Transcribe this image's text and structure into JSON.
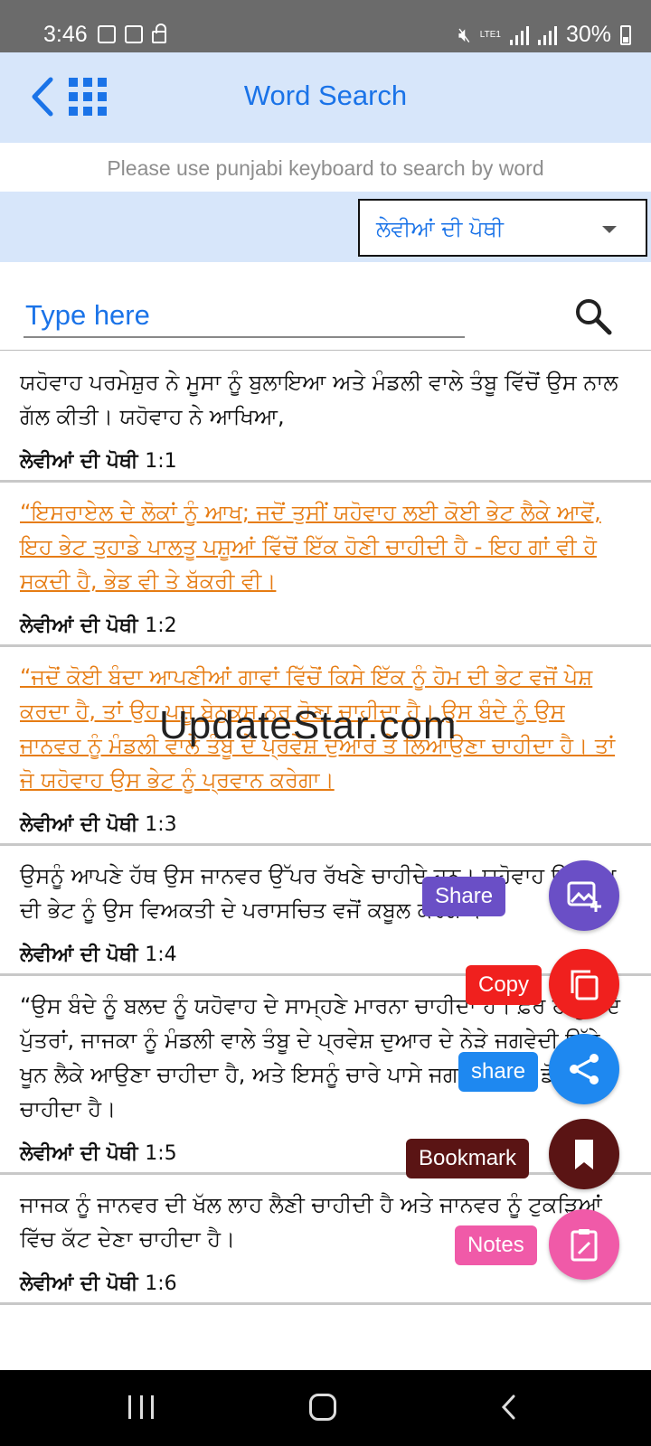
{
  "status_bar": {
    "time": "3:46",
    "battery": "30%",
    "network": "LTE1",
    "icons": [
      "image-icon",
      "news-icon",
      "lock-icon",
      "mute-icon",
      "signal-icon",
      "battery-icon"
    ]
  },
  "header": {
    "title": "Word Search",
    "back_icon": "chevron-left-icon",
    "menu_icon": "grid-icon",
    "accent_color": "#1a73e8",
    "background_color": "#d7e6fa"
  },
  "hint": "Please use punjabi keyboard to search by word",
  "book_select": {
    "value": "ਲੇਵੀਆਂ ਦੀ ਪੋਥੀ"
  },
  "search": {
    "placeholder": "Type here",
    "value": ""
  },
  "verses": [
    {
      "text": "ਯਹੋਵਾਹ ਪਰਮੇਸ਼ੁਰ ਨੇ ਮੂਸਾ ਨੂੰ ਬੁਲਾਇਆ ਅਤੇ ਮੰਡਲੀ ਵਾਲੇ ਤੰਬੂ ਵਿੱਚੋਂ ਉਸ ਨਾਲ ਗੱਲ ਕੀਤੀ। ਯਹੋਵਾਹ ਨੇ ਆਖਿਆ,",
      "book": "ਲੇਵੀਆਂ ਦੀ ਪੋਥੀ",
      "ref": "1:1",
      "highlighted": false
    },
    {
      "text": "“ਇਸਰਾਏਲ ਦੇ ਲੋਕਾਂ ਨੂੰ ਆਖ; ਜਦੋਂ ਤੁਸੀਂ ਯਹੋਵਾਹ ਲਈ ਕੋਈ ਭੇਟ ਲੈਕੇ ਆਵੋਂ, ਇਹ ਭੇਟ ਤੁਹਾਡੇ ਪਾਲਤੂ ਪਸ਼ੂਆਂ ਵਿੱਚੋਂ ਇੱਕ ਹੋਣੀ ਚਾਹੀਦੀ ਹੈ - ਇਹ ਗਾਂ ਵੀ ਹੋ ਸਕਦੀ ਹੈ, ਭੇਡ ਵੀ ਤੇ ਬੱਕਰੀ ਵੀ।",
      "book": "ਲੇਵੀਆਂ ਦੀ ਪੋਥੀ",
      "ref": "1:2",
      "highlighted": true
    },
    {
      "text": "“ਜਦੋਂ ਕੋਈ ਬੰਦਾ ਆਪਣੀਆਂ ਗਾਵਾਂ ਵਿੱਚੋਂ ਕਿਸੇ ਇੱਕ ਨੂੰ ਹੋਮ ਦੀ ਭੇਟ ਵਜੋਂ ਪੇਸ਼ ਕਰਦਾ ਹੈ, ਤਾਂ ਉਹ ਪਸ਼ੂ ਬੇਨੁਕਸ ਨਰ ਹੋਣਾ ਚਾਹੀਦਾ ਹੈ। ਉਸ ਬੰਦੇ ਨੂੰ ਉਸ ਜਾਨਵਰ ਨੂੰ ਮੰਡਲੀ ਵਾਲੇ ਤੰਬੂ ਦੇ ਪ੍ਰਵੇਸ਼ ਦੁਆਰ ਤੇ ਲਿਆਉਣਾ ਚਾਹੀਦਾ ਹੈ। ਤਾਂ ਜੋ ਯਹੋਵਾਹ ਉਸ ਭੇਟ ਨੂੰ ਪ੍ਰਵਾਨ ਕਰੇਗਾ।",
      "book": "ਲੇਵੀਆਂ ਦੀ ਪੋਥੀ",
      "ref": "1:3",
      "highlighted": true
    },
    {
      "text": "ਉਸਨੂੰ ਆਪਣੇ ਹੱਥ ਉਸ ਜਾਨਵਰ ਉੱਪਰ ਰੱਖਣੇ ਚਾਹੀਦੇ ਹਨ। ਯਹੋਵਾਹ ਉਸ ਹੋਮ ਦੀ ਭੇਟ ਨੂੰ ਉਸ ਵਿਅਕਤੀ ਦੇ ਪਰਾਸਚਿਤ ਵਜੋਂ ਕਬੂਲ ਕਰੇਗਾ।",
      "book": "ਲੇਵੀਆਂ ਦੀ ਪੋਥੀ",
      "ref": "1:4",
      "highlighted": false
    },
    {
      "text": "“ਉਸ ਬੰਦੇ ਨੂੰ ਬਲਦ ਨੂੰ ਯਹੋਵਾਹ ਦੇ ਸਾਮ੍ਹਣੇ ਮਾਰਨਾ ਚਾਹੀਦਾ ਹੈ। ਫ਼ੇਰ ਹਾਰੂਨ ਦੇ ਪੁੱਤਰਾਂ, ਜਾਜਕਾ ਨੂੰ ਮੰਡਲੀ ਵਾਲੇ ਤੰਬੂ ਦੇ ਪ੍ਰਵੇਸ਼ ਦੁਆਰ ਦੇ ਨੇੜੇ ਜਗਵੇਦੀ ਉੱਤੇ ਖੂਨ ਲੈਕੇ ਆਉਣਾ ਚਾਹੀਦਾ ਹੈ, ਅਤੇ ਇਸਨੂੰ ਚਾਰੇ ਪਾਸੇ ਜਗਵੇਦੀ ਉੱਤੇ ਡੋਲ੍ਹਣਾ ਚਾਹੀਦਾ ਹੈ।",
      "book": "ਲੇਵੀਆਂ ਦੀ ਪੋਥੀ",
      "ref": "1:5",
      "highlighted": false
    },
    {
      "text": "ਜਾਜਕ ਨੂੰ ਜਾਨਵਰ ਦੀ ਖੱਲ ਲਾਹ ਲੈਣੀ ਚਾਹੀਦੀ ਹੈ ਅਤੇ ਜਾਨਵਰ ਨੂੰ ਟੁਕੜਿਆਂ ਵਿੱਚ ਕੱਟ ਦੇਣਾ ਚਾਹੀਦਾ ਹੈ।",
      "book": "ਲੇਵੀਆਂ ਦੀ ਪੋਥੀ",
      "ref": "1:6",
      "highlighted": false
    }
  ],
  "highlight_color": "#e67c13",
  "fab_menu": {
    "share_image": {
      "label": "Share",
      "icon": "image-add-icon",
      "color": "#6a4fc6"
    },
    "copy": {
      "label": "Copy",
      "icon": "copy-icon",
      "color": "#f0201e"
    },
    "share": {
      "label": "share",
      "icon": "share-icon",
      "color": "#1e88f0"
    },
    "bookmark": {
      "label": "Bookmark",
      "icon": "bookmark-icon",
      "color": "#5a1414"
    },
    "notes": {
      "label": "Notes",
      "icon": "notes-icon",
      "color": "#f05aa8"
    }
  },
  "watermark": "UpdateStar.com",
  "nav_bar": {
    "icons": [
      "recent-apps-icon",
      "home-icon",
      "back-icon"
    ]
  }
}
